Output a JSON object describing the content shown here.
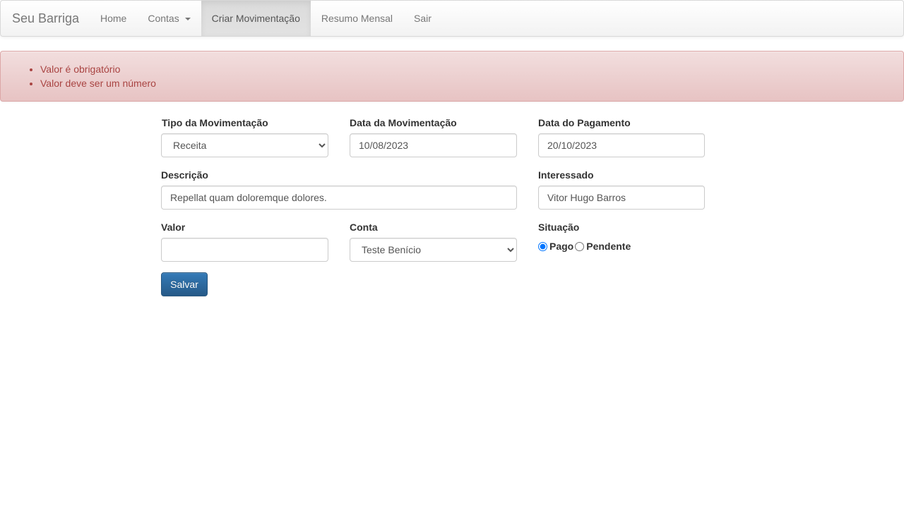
{
  "navbar": {
    "brand": "Seu Barriga",
    "items": [
      {
        "label": "Home"
      },
      {
        "label": "Contas"
      },
      {
        "label": "Criar Movimentação"
      },
      {
        "label": "Resumo Mensal"
      },
      {
        "label": "Sair"
      }
    ]
  },
  "alert": {
    "errors": [
      "Valor é obrigatório",
      "Valor deve ser um número"
    ]
  },
  "form": {
    "tipo": {
      "label": "Tipo da Movimentação",
      "value": "Receita"
    },
    "data_movimentacao": {
      "label": "Data da Movimentação",
      "value": "10/08/2023"
    },
    "data_pagamento": {
      "label": "Data do Pagamento",
      "value": "20/10/2023"
    },
    "descricao": {
      "label": "Descrição",
      "value": "Repellat quam doloremque dolores."
    },
    "interessado": {
      "label": "Interessado",
      "value": "Vitor Hugo Barros"
    },
    "valor": {
      "label": "Valor",
      "value": ""
    },
    "conta": {
      "label": "Conta",
      "value": "Teste Benício"
    },
    "situacao": {
      "label": "Situação",
      "options": [
        {
          "label": "Pago",
          "checked": true
        },
        {
          "label": "Pendente",
          "checked": false
        }
      ]
    },
    "submit_label": "Salvar"
  },
  "colors": {
    "primary": "#337ab7",
    "alert_text": "#a94442",
    "alert_bg": "#f2dede"
  }
}
